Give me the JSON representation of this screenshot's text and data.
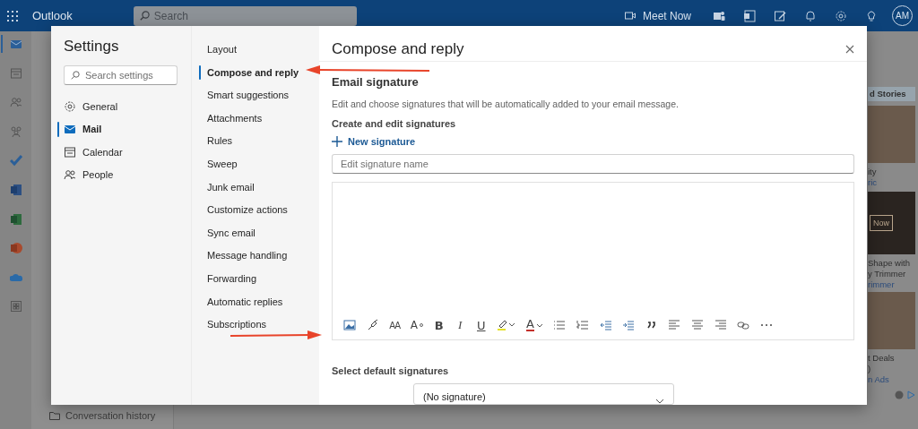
{
  "topbar": {
    "app_name": "Outlook",
    "search_placeholder": "Search",
    "meet_now": "Meet Now",
    "avatar_initials": "AM"
  },
  "rail": [
    {
      "kind": "mail",
      "selected": true
    },
    {
      "kind": "calendar",
      "selected": false
    },
    {
      "kind": "people",
      "selected": false
    },
    {
      "kind": "groups",
      "selected": false
    },
    {
      "kind": "todo",
      "selected": false
    },
    {
      "kind": "word",
      "selected": false
    },
    {
      "kind": "excel",
      "selected": false
    },
    {
      "kind": "powerpoint",
      "selected": false
    },
    {
      "kind": "onedrive",
      "selected": false
    },
    {
      "kind": "apps",
      "selected": false
    }
  ],
  "background": {
    "folder_item": "Conversation history",
    "ads": {
      "header": "d Stories",
      "blocks": [
        {
          "kind": "photo",
          "lines": [
            "ity",
            "ric"
          ]
        },
        {
          "kind": "video",
          "button": "Now",
          "lines": [
            "Shape with",
            "y Trimmer",
            "rimmer"
          ]
        },
        {
          "kind": "photo",
          "lines": [
            "t Deals",
            ")",
            "n Ads"
          ]
        }
      ]
    }
  },
  "settings": {
    "title": "Settings",
    "search_placeholder": "Search settings",
    "categories": [
      {
        "label": "General",
        "kind": "gear",
        "selected": false
      },
      {
        "label": "Mail",
        "kind": "mail",
        "selected": true
      },
      {
        "label": "Calendar",
        "kind": "calendar",
        "selected": false
      },
      {
        "label": "People",
        "kind": "people",
        "selected": false
      }
    ],
    "subcategories": [
      {
        "label": "Layout",
        "selected": false
      },
      {
        "label": "Compose and reply",
        "selected": true
      },
      {
        "label": "Smart suggestions",
        "selected": false
      },
      {
        "label": "Attachments",
        "selected": false
      },
      {
        "label": "Rules",
        "selected": false
      },
      {
        "label": "Sweep",
        "selected": false
      },
      {
        "label": "Junk email",
        "selected": false
      },
      {
        "label": "Customize actions",
        "selected": false
      },
      {
        "label": "Sync email",
        "selected": false
      },
      {
        "label": "Message handling",
        "selected": false
      },
      {
        "label": "Forwarding",
        "selected": false
      },
      {
        "label": "Automatic replies",
        "selected": false
      },
      {
        "label": "Subscriptions",
        "selected": false
      }
    ],
    "panel": {
      "title": "Compose and reply",
      "section_title": "Email signature",
      "description": "Edit and choose signatures that will be automatically added to your email message.",
      "subsection": "Create and edit signatures",
      "new_signature": "New signature",
      "name_placeholder": "Edit signature name",
      "toolbar": [
        {
          "kind": "picture"
        },
        {
          "kind": "brush"
        },
        {
          "kind": "font-size",
          "glyph": "AA"
        },
        {
          "kind": "superscript",
          "glyph": "A"
        },
        {
          "kind": "bold",
          "glyph": "B"
        },
        {
          "kind": "italic",
          "glyph": "I"
        },
        {
          "kind": "underline",
          "glyph": "U"
        },
        {
          "kind": "highlight"
        },
        {
          "kind": "font-color",
          "glyph": "A"
        },
        {
          "kind": "bullets"
        },
        {
          "kind": "numbering"
        },
        {
          "kind": "outdent"
        },
        {
          "kind": "indent"
        },
        {
          "kind": "quote"
        },
        {
          "kind": "align-left"
        },
        {
          "kind": "align-center"
        },
        {
          "kind": "align-right"
        },
        {
          "kind": "link"
        },
        {
          "kind": "more"
        }
      ],
      "default_heading": "Select default signatures",
      "default_value": "(No signature)"
    }
  }
}
